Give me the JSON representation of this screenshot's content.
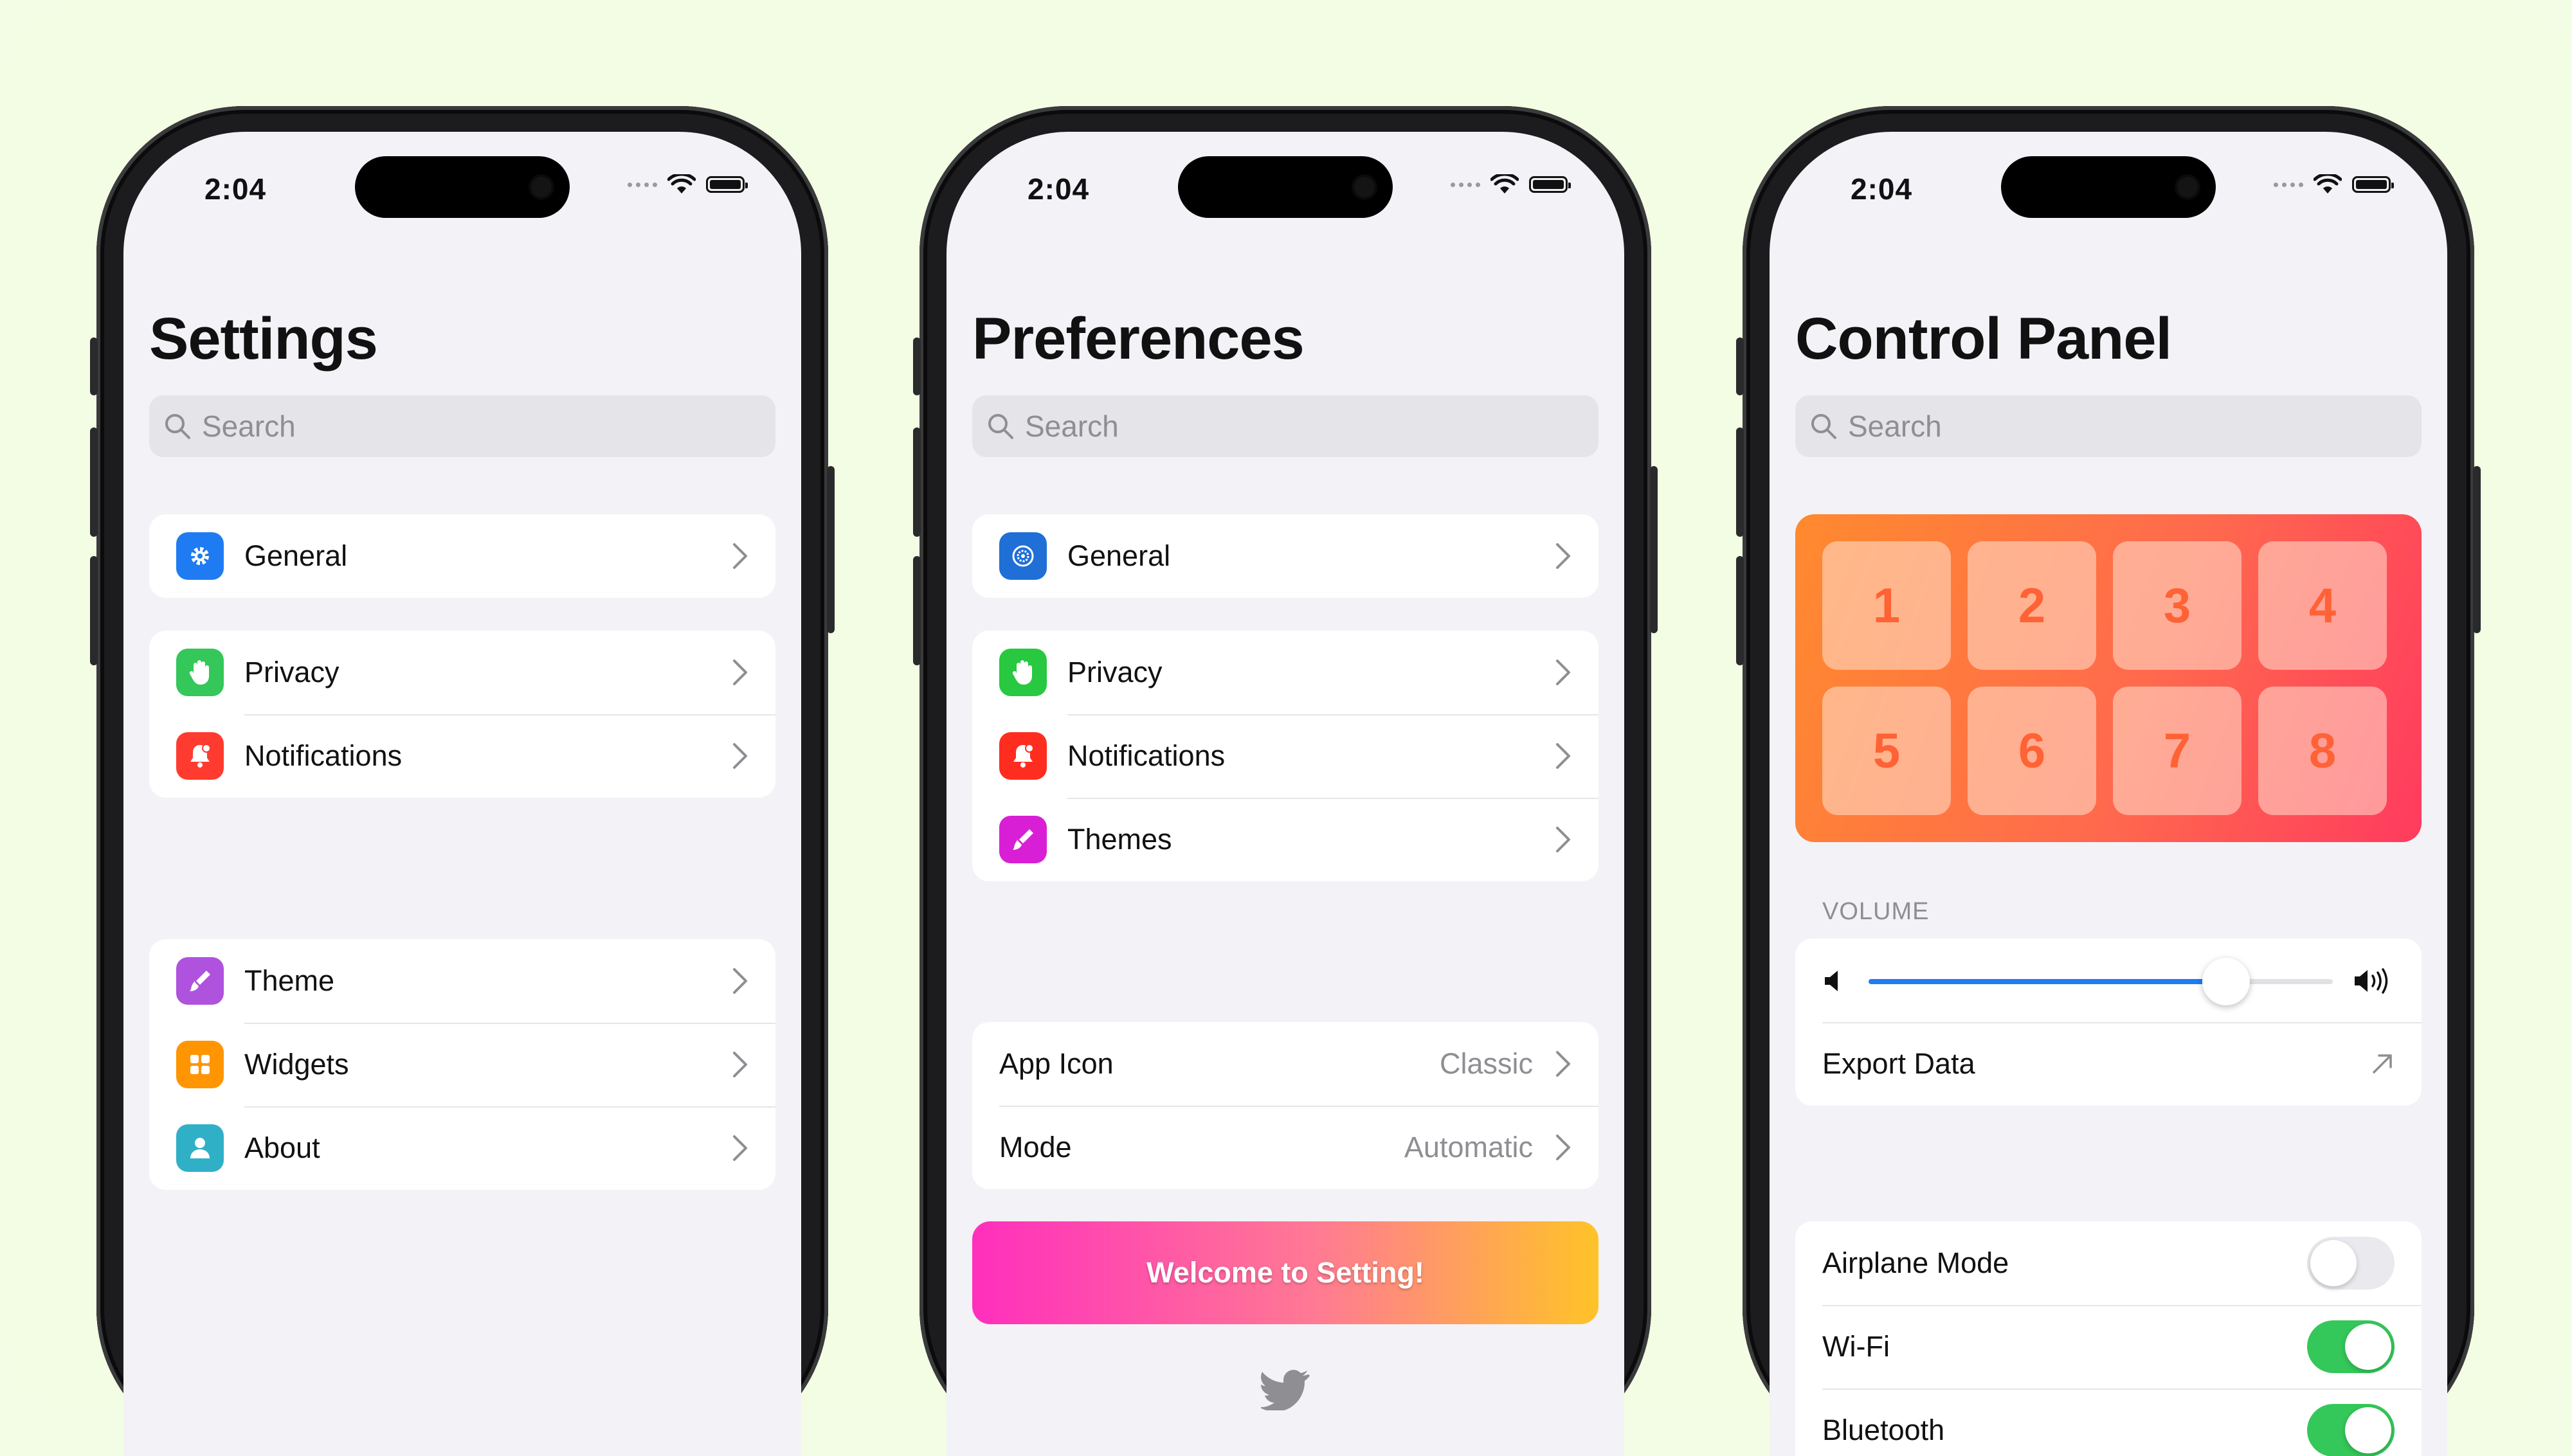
{
  "status": {
    "time": "2:04"
  },
  "phones": [
    {
      "title": "Settings",
      "search_placeholder": "Search",
      "items": {
        "general": "General",
        "privacy": "Privacy",
        "notifications": "Notifications",
        "theme": "Theme",
        "widgets": "Widgets",
        "about": "About"
      }
    },
    {
      "title": "Preferences",
      "search_placeholder": "Search",
      "items": {
        "general": "General",
        "privacy": "Privacy",
        "notifications": "Notifications",
        "themes": "Themes",
        "app_icon": "App Icon",
        "app_icon_value": "Classic",
        "mode": "Mode",
        "mode_value": "Automatic"
      },
      "welcome_button": "Welcome to Setting!",
      "footer_icon": "twitter-bird-icon"
    },
    {
      "title": "Control Panel",
      "search_placeholder": "Search",
      "pad_keys": [
        "1",
        "2",
        "3",
        "4",
        "5",
        "6",
        "7",
        "8"
      ],
      "volume_label": "VOLUME",
      "volume_level": 0.77,
      "export_label": "Export Data",
      "toggles": [
        {
          "label": "Airplane Mode",
          "on": false
        },
        {
          "label": "Wi-Fi",
          "on": true
        },
        {
          "label": "Bluetooth",
          "on": true
        }
      ]
    }
  ],
  "colors": {
    "general_blue": "#1f7bf2",
    "privacy_green": "#34c759",
    "notifications_red": "#ff3b30",
    "theme_purple": "#af52de",
    "widgets_orange": "#ff9500",
    "about_teal": "#30b0c7",
    "toggle_on": "#34c759",
    "slider_blue": "#1f7bf2"
  }
}
